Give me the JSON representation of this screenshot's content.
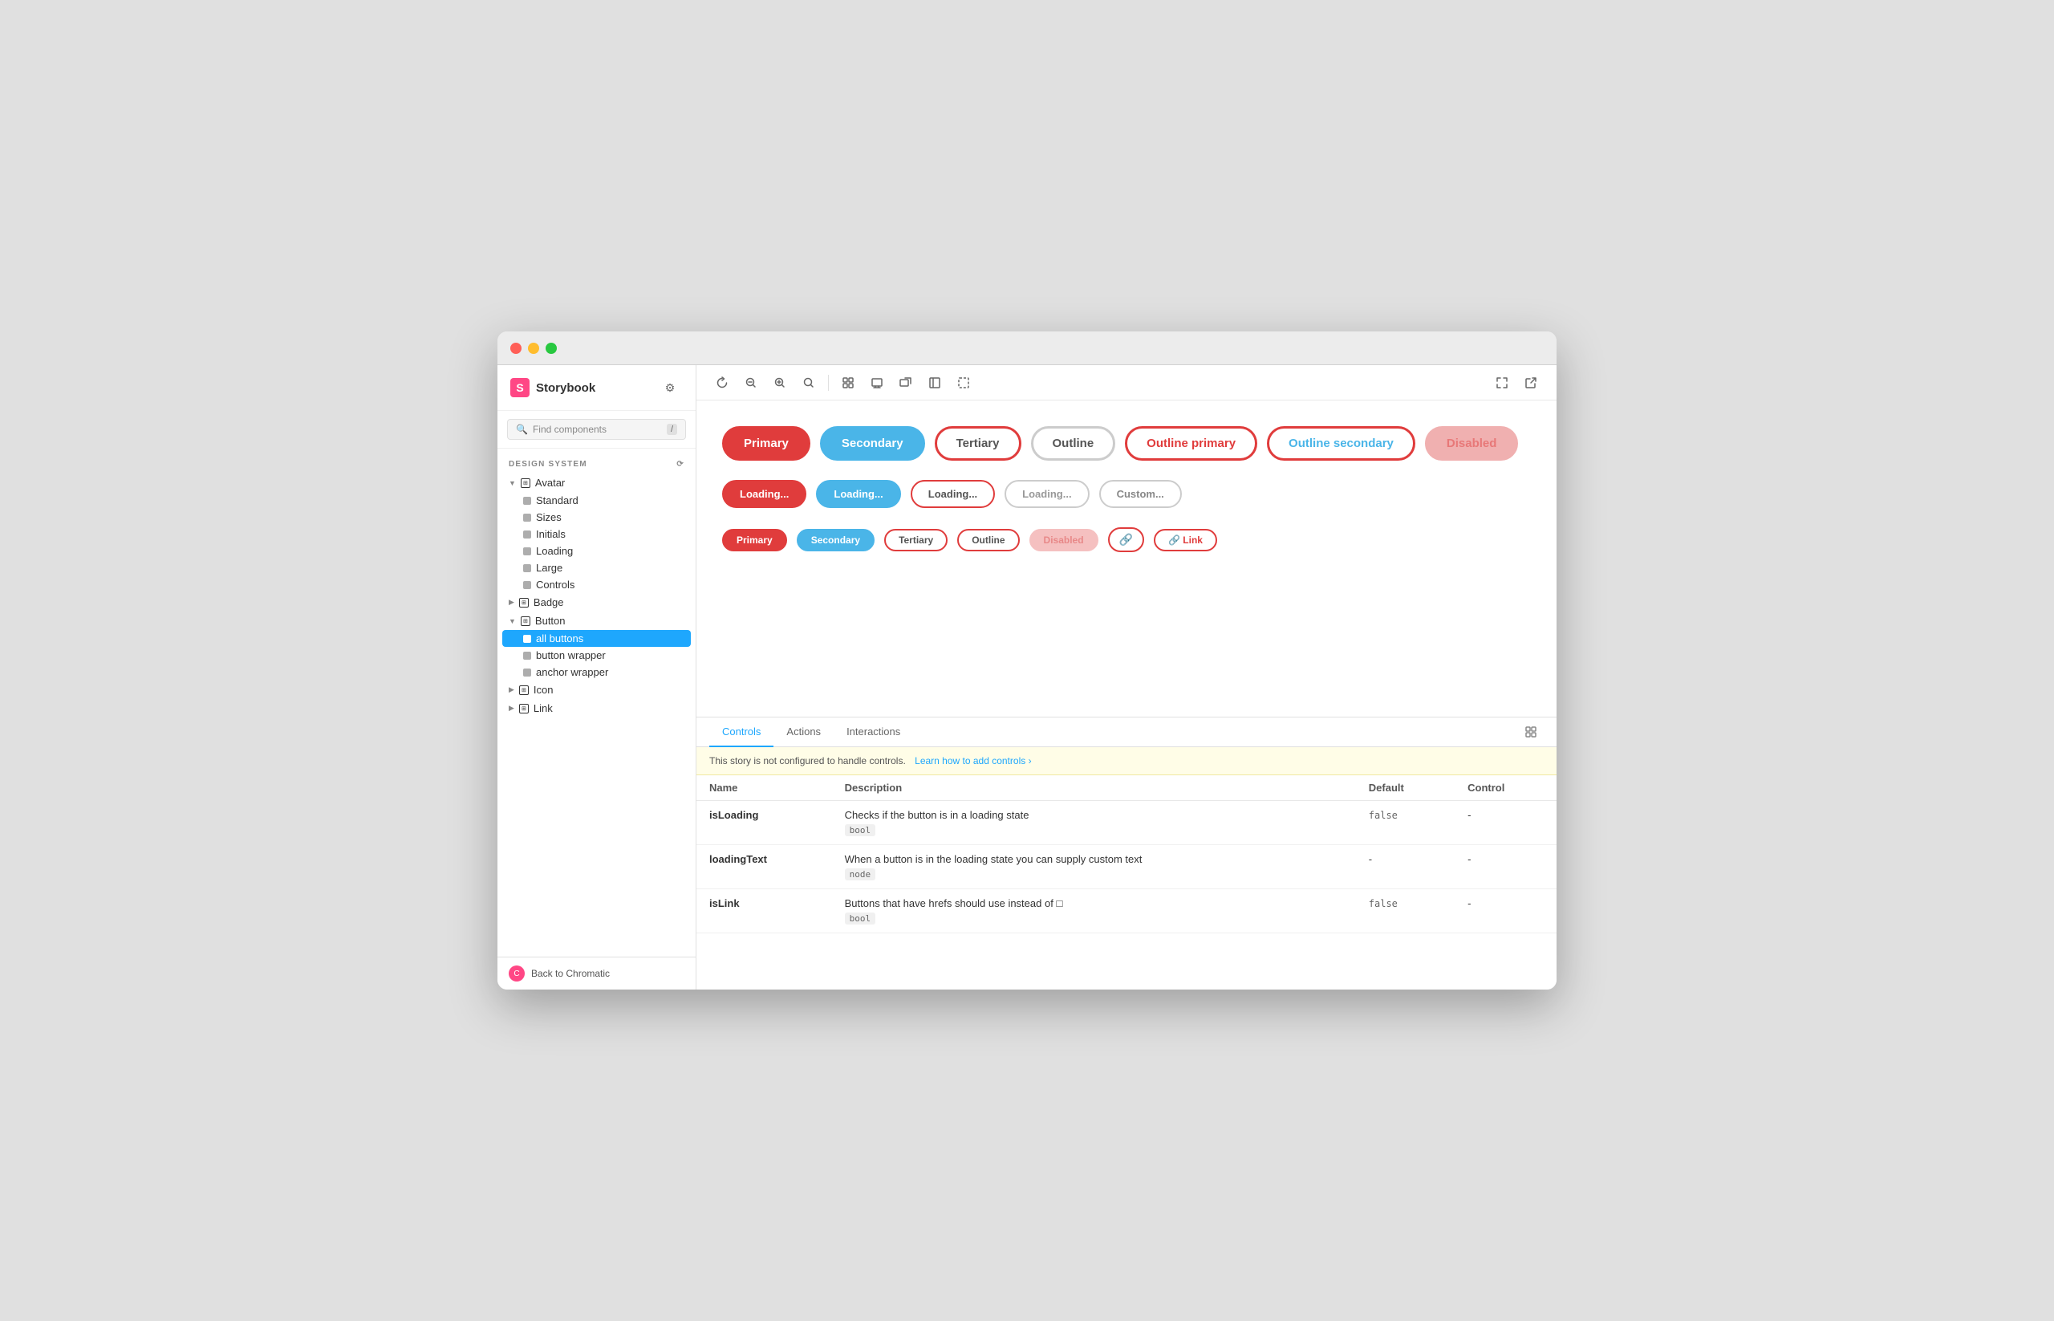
{
  "window": {
    "title": "Storybook"
  },
  "sidebar": {
    "logo": "Storybook",
    "search": {
      "placeholder": "Find components",
      "shortcut": "/"
    },
    "section_label": "DESIGN SYSTEM",
    "nav": [
      {
        "type": "group",
        "label": "Avatar",
        "expanded": true,
        "children": [
          {
            "label": "Standard"
          },
          {
            "label": "Sizes"
          },
          {
            "label": "Initials"
          },
          {
            "label": "Loading"
          },
          {
            "label": "Large"
          },
          {
            "label": "Controls"
          }
        ]
      },
      {
        "type": "group",
        "label": "Badge",
        "expanded": false,
        "children": []
      },
      {
        "type": "group",
        "label": "Button",
        "expanded": true,
        "children": [
          {
            "label": "all buttons",
            "active": true
          },
          {
            "label": "button wrapper"
          },
          {
            "label": "anchor wrapper"
          }
        ]
      },
      {
        "type": "group",
        "label": "Icon",
        "expanded": false,
        "children": []
      },
      {
        "type": "group",
        "label": "Link",
        "expanded": false,
        "children": []
      }
    ],
    "footer": {
      "label": "Back to Chromatic"
    }
  },
  "toolbar": {
    "buttons": [
      "↺",
      "🔍-",
      "🔍+",
      "↺",
      "⊞",
      "⊟",
      "⊡",
      "⊞",
      "⊟"
    ]
  },
  "preview": {
    "row1": [
      {
        "label": "Primary",
        "style": "primary-lg"
      },
      {
        "label": "Secondary",
        "style": "secondary-lg"
      },
      {
        "label": "Tertiary",
        "style": "tertiary-lg"
      },
      {
        "label": "Outline",
        "style": "outline-lg"
      },
      {
        "label": "Outline primary",
        "style": "outline-primary-lg"
      },
      {
        "label": "Outline secondary",
        "style": "outline-secondary-lg"
      },
      {
        "label": "Disabled",
        "style": "disabled-lg"
      }
    ],
    "row2": [
      {
        "label": "Loading...",
        "style": "loading-primary"
      },
      {
        "label": "Loading...",
        "style": "loading-secondary"
      },
      {
        "label": "Loading...",
        "style": "loading-tertiary"
      },
      {
        "label": "Loading...",
        "style": "loading-outline"
      },
      {
        "label": "Custom...",
        "style": "custom"
      }
    ],
    "row3": [
      {
        "label": "Primary",
        "style": "sm-primary"
      },
      {
        "label": "Secondary",
        "style": "sm-secondary"
      },
      {
        "label": "Tertiary",
        "style": "sm-tertiary"
      },
      {
        "label": "Outline",
        "style": "sm-outline"
      },
      {
        "label": "Disabled",
        "style": "sm-disabled"
      },
      {
        "label": "🔗",
        "style": "sm-icon"
      },
      {
        "label": "🔗 Link",
        "style": "sm-link"
      }
    ]
  },
  "controls_panel": {
    "tabs": [
      "Controls",
      "Actions",
      "Interactions"
    ],
    "active_tab": "Controls",
    "info_banner": {
      "text": "This story is not configured to handle controls.",
      "link_text": "Learn how to add controls",
      "link_symbol": "›"
    },
    "table": {
      "headers": [
        "Name",
        "Description",
        "Default",
        "Control"
      ],
      "rows": [
        {
          "name": "isLoading",
          "description": "Checks if the button is in a loading state",
          "type": "bool",
          "default": "false",
          "control": "-"
        },
        {
          "name": "loadingText",
          "description": "When a button is in the loading state you can supply custom text",
          "type": "node",
          "default": "-",
          "control": "-"
        },
        {
          "name": "isLink",
          "description": "Buttons that have hrefs should use instead of",
          "description_note": "□",
          "type": "bool",
          "default": "false",
          "control": "-"
        }
      ]
    }
  }
}
